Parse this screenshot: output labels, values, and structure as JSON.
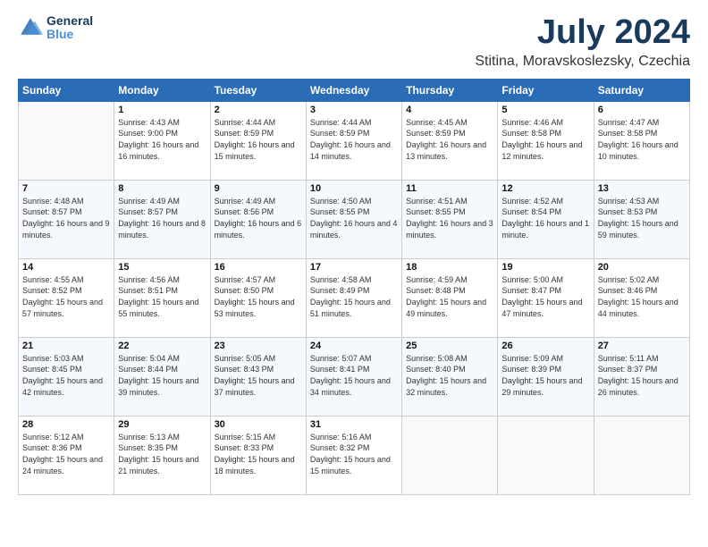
{
  "logo": {
    "line1": "General",
    "line2": "Blue"
  },
  "title": "July 2024",
  "subtitle": "Stitina, Moravskoslezsky, Czechia",
  "days_of_week": [
    "Sunday",
    "Monday",
    "Tuesday",
    "Wednesday",
    "Thursday",
    "Friday",
    "Saturday"
  ],
  "weeks": [
    [
      {
        "day": "",
        "sunrise": "",
        "sunset": "",
        "daylight": ""
      },
      {
        "day": "1",
        "sunrise": "Sunrise: 4:43 AM",
        "sunset": "Sunset: 9:00 PM",
        "daylight": "Daylight: 16 hours and 16 minutes."
      },
      {
        "day": "2",
        "sunrise": "Sunrise: 4:44 AM",
        "sunset": "Sunset: 8:59 PM",
        "daylight": "Daylight: 16 hours and 15 minutes."
      },
      {
        "day": "3",
        "sunrise": "Sunrise: 4:44 AM",
        "sunset": "Sunset: 8:59 PM",
        "daylight": "Daylight: 16 hours and 14 minutes."
      },
      {
        "day": "4",
        "sunrise": "Sunrise: 4:45 AM",
        "sunset": "Sunset: 8:59 PM",
        "daylight": "Daylight: 16 hours and 13 minutes."
      },
      {
        "day": "5",
        "sunrise": "Sunrise: 4:46 AM",
        "sunset": "Sunset: 8:58 PM",
        "daylight": "Daylight: 16 hours and 12 minutes."
      },
      {
        "day": "6",
        "sunrise": "Sunrise: 4:47 AM",
        "sunset": "Sunset: 8:58 PM",
        "daylight": "Daylight: 16 hours and 10 minutes."
      }
    ],
    [
      {
        "day": "7",
        "sunrise": "Sunrise: 4:48 AM",
        "sunset": "Sunset: 8:57 PM",
        "daylight": "Daylight: 16 hours and 9 minutes."
      },
      {
        "day": "8",
        "sunrise": "Sunrise: 4:49 AM",
        "sunset": "Sunset: 8:57 PM",
        "daylight": "Daylight: 16 hours and 8 minutes."
      },
      {
        "day": "9",
        "sunrise": "Sunrise: 4:49 AM",
        "sunset": "Sunset: 8:56 PM",
        "daylight": "Daylight: 16 hours and 6 minutes."
      },
      {
        "day": "10",
        "sunrise": "Sunrise: 4:50 AM",
        "sunset": "Sunset: 8:55 PM",
        "daylight": "Daylight: 16 hours and 4 minutes."
      },
      {
        "day": "11",
        "sunrise": "Sunrise: 4:51 AM",
        "sunset": "Sunset: 8:55 PM",
        "daylight": "Daylight: 16 hours and 3 minutes."
      },
      {
        "day": "12",
        "sunrise": "Sunrise: 4:52 AM",
        "sunset": "Sunset: 8:54 PM",
        "daylight": "Daylight: 16 hours and 1 minute."
      },
      {
        "day": "13",
        "sunrise": "Sunrise: 4:53 AM",
        "sunset": "Sunset: 8:53 PM",
        "daylight": "Daylight: 15 hours and 59 minutes."
      }
    ],
    [
      {
        "day": "14",
        "sunrise": "Sunrise: 4:55 AM",
        "sunset": "Sunset: 8:52 PM",
        "daylight": "Daylight: 15 hours and 57 minutes."
      },
      {
        "day": "15",
        "sunrise": "Sunrise: 4:56 AM",
        "sunset": "Sunset: 8:51 PM",
        "daylight": "Daylight: 15 hours and 55 minutes."
      },
      {
        "day": "16",
        "sunrise": "Sunrise: 4:57 AM",
        "sunset": "Sunset: 8:50 PM",
        "daylight": "Daylight: 15 hours and 53 minutes."
      },
      {
        "day": "17",
        "sunrise": "Sunrise: 4:58 AM",
        "sunset": "Sunset: 8:49 PM",
        "daylight": "Daylight: 15 hours and 51 minutes."
      },
      {
        "day": "18",
        "sunrise": "Sunrise: 4:59 AM",
        "sunset": "Sunset: 8:48 PM",
        "daylight": "Daylight: 15 hours and 49 minutes."
      },
      {
        "day": "19",
        "sunrise": "Sunrise: 5:00 AM",
        "sunset": "Sunset: 8:47 PM",
        "daylight": "Daylight: 15 hours and 47 minutes."
      },
      {
        "day": "20",
        "sunrise": "Sunrise: 5:02 AM",
        "sunset": "Sunset: 8:46 PM",
        "daylight": "Daylight: 15 hours and 44 minutes."
      }
    ],
    [
      {
        "day": "21",
        "sunrise": "Sunrise: 5:03 AM",
        "sunset": "Sunset: 8:45 PM",
        "daylight": "Daylight: 15 hours and 42 minutes."
      },
      {
        "day": "22",
        "sunrise": "Sunrise: 5:04 AM",
        "sunset": "Sunset: 8:44 PM",
        "daylight": "Daylight: 15 hours and 39 minutes."
      },
      {
        "day": "23",
        "sunrise": "Sunrise: 5:05 AM",
        "sunset": "Sunset: 8:43 PM",
        "daylight": "Daylight: 15 hours and 37 minutes."
      },
      {
        "day": "24",
        "sunrise": "Sunrise: 5:07 AM",
        "sunset": "Sunset: 8:41 PM",
        "daylight": "Daylight: 15 hours and 34 minutes."
      },
      {
        "day": "25",
        "sunrise": "Sunrise: 5:08 AM",
        "sunset": "Sunset: 8:40 PM",
        "daylight": "Daylight: 15 hours and 32 minutes."
      },
      {
        "day": "26",
        "sunrise": "Sunrise: 5:09 AM",
        "sunset": "Sunset: 8:39 PM",
        "daylight": "Daylight: 15 hours and 29 minutes."
      },
      {
        "day": "27",
        "sunrise": "Sunrise: 5:11 AM",
        "sunset": "Sunset: 8:37 PM",
        "daylight": "Daylight: 15 hours and 26 minutes."
      }
    ],
    [
      {
        "day": "28",
        "sunrise": "Sunrise: 5:12 AM",
        "sunset": "Sunset: 8:36 PM",
        "daylight": "Daylight: 15 hours and 24 minutes."
      },
      {
        "day": "29",
        "sunrise": "Sunrise: 5:13 AM",
        "sunset": "Sunset: 8:35 PM",
        "daylight": "Daylight: 15 hours and 21 minutes."
      },
      {
        "day": "30",
        "sunrise": "Sunrise: 5:15 AM",
        "sunset": "Sunset: 8:33 PM",
        "daylight": "Daylight: 15 hours and 18 minutes."
      },
      {
        "day": "31",
        "sunrise": "Sunrise: 5:16 AM",
        "sunset": "Sunset: 8:32 PM",
        "daylight": "Daylight: 15 hours and 15 minutes."
      },
      {
        "day": "",
        "sunrise": "",
        "sunset": "",
        "daylight": ""
      },
      {
        "day": "",
        "sunrise": "",
        "sunset": "",
        "daylight": ""
      },
      {
        "day": "",
        "sunrise": "",
        "sunset": "",
        "daylight": ""
      }
    ]
  ]
}
